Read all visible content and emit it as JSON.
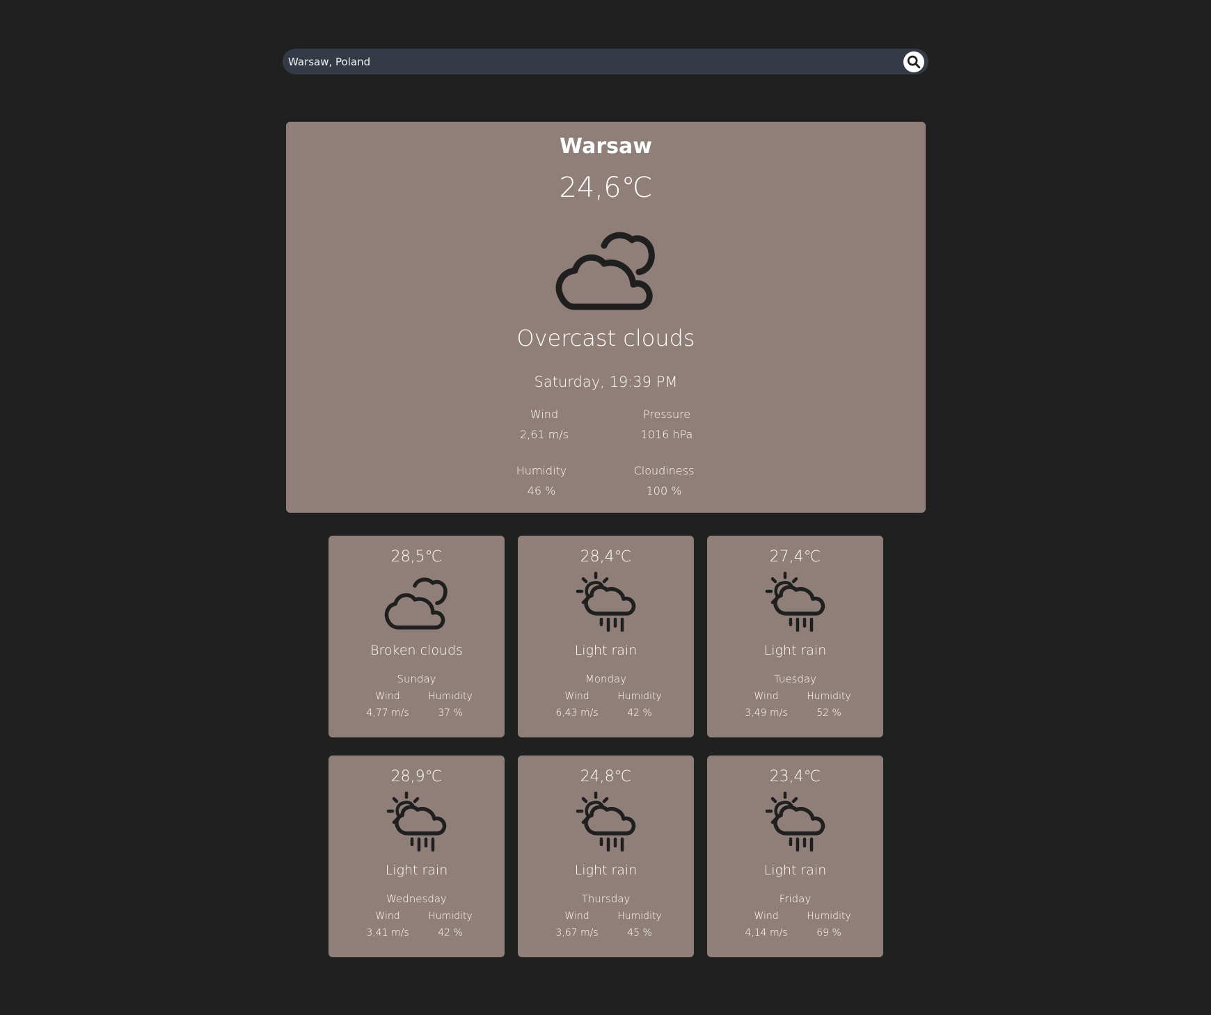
{
  "search": {
    "value": "Warsaw, Poland",
    "icon": "search-icon"
  },
  "current": {
    "city": "Warsaw",
    "temperature": "24,6℃",
    "icon": "overcast-clouds-icon",
    "description": "Overcast clouds",
    "date": "Saturday, 19:39 PM",
    "wind_label": "Wind",
    "wind_value": "2,61 m/s",
    "pressure_label": "Pressure",
    "pressure_value": "1016 hPa",
    "humidity_label": "Humidity",
    "humidity_value": "46 %",
    "cloudiness_label": "Cloudiness",
    "cloudiness_value": "100 %"
  },
  "forecast": [
    {
      "temperature": "28,5℃",
      "icon": "broken-clouds-icon",
      "description": "Broken clouds",
      "day": "Sunday",
      "wind_label": "Wind",
      "wind_value": "4,77 m/s",
      "humidity_label": "Humidity",
      "humidity_value": "37 %"
    },
    {
      "temperature": "28,4℃",
      "icon": "light-rain-icon",
      "description": "Light rain",
      "day": "Monday",
      "wind_label": "Wind",
      "wind_value": "6,43 m/s",
      "humidity_label": "Humidity",
      "humidity_value": "42 %"
    },
    {
      "temperature": "27,4℃",
      "icon": "light-rain-icon",
      "description": "Light rain",
      "day": "Tuesday",
      "wind_label": "Wind",
      "wind_value": "3,49 m/s",
      "humidity_label": "Humidity",
      "humidity_value": "52 %"
    },
    {
      "temperature": "28,9℃",
      "icon": "light-rain-icon",
      "description": "Light rain",
      "day": "Wednesday",
      "wind_label": "Wind",
      "wind_value": "3,41 m/s",
      "humidity_label": "Humidity",
      "humidity_value": "42 %"
    },
    {
      "temperature": "24,8℃",
      "icon": "light-rain-icon",
      "description": "Light rain",
      "day": "Thursday",
      "wind_label": "Wind",
      "wind_value": "3,67 m/s",
      "humidity_label": "Humidity",
      "humidity_value": "45 %"
    },
    {
      "temperature": "23,4℃",
      "icon": "light-rain-icon",
      "description": "Light rain",
      "day": "Friday",
      "wind_label": "Wind",
      "wind_value": "4,14 m/s",
      "humidity_label": "Humidity",
      "humidity_value": "69 %"
    }
  ],
  "colors": {
    "background": "#202020",
    "search_bar": "#353a47",
    "card": "#907f78",
    "text": "#ffffff",
    "icon": "#1f1f1f"
  }
}
